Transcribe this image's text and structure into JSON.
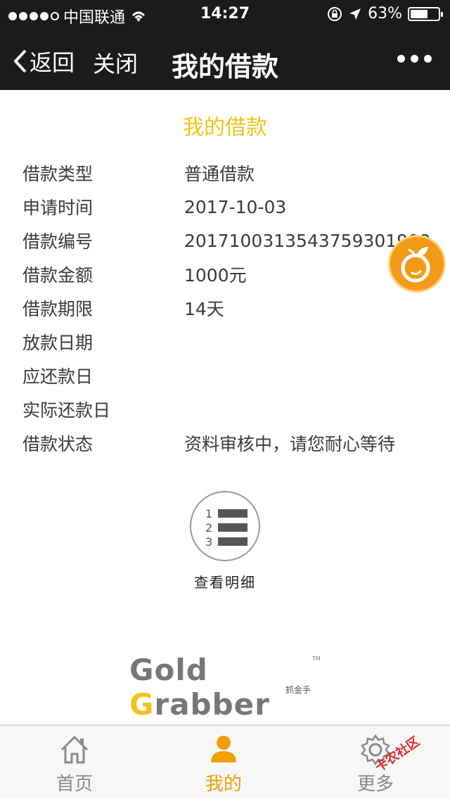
{
  "status_bar": {
    "carrier": "中国联通",
    "time": "14:27",
    "battery_percent_text": "63%",
    "battery_level": 0.63
  },
  "nav": {
    "back_label": "返回",
    "close_label": "关闭",
    "title": "我的借款"
  },
  "page": {
    "heading": "我的借款",
    "accent_color": "#f1c31b"
  },
  "details": [
    {
      "label": "借款类型",
      "value": "普通借款"
    },
    {
      "label": "申请时间",
      "value": "2017-10-03"
    },
    {
      "label": "借款编号",
      "value": "20171003135437593019084"
    },
    {
      "label": "借款金额",
      "value": "1000元"
    },
    {
      "label": "借款期限",
      "value": "14天"
    },
    {
      "label": "放款日期",
      "value": ""
    },
    {
      "label": "应还款日",
      "value": ""
    },
    {
      "label": "实际还款日",
      "value": ""
    },
    {
      "label": "借款状态",
      "value": "资料审核中，请您耐心等待"
    }
  ],
  "detail_button": {
    "label": "查看明细",
    "list_numbers": [
      "1",
      "2",
      "3"
    ]
  },
  "logo": {
    "text_part1": "Gold ",
    "text_part2": "G",
    "text_part3": "rabber",
    "tm": "TM",
    "chinese": "抓金手"
  },
  "tabbar": {
    "home_label": "首页",
    "mine_label": "我的",
    "more_label": "更多",
    "active_color": "#f1a000"
  },
  "watermark": {
    "text": "卡农社区"
  }
}
